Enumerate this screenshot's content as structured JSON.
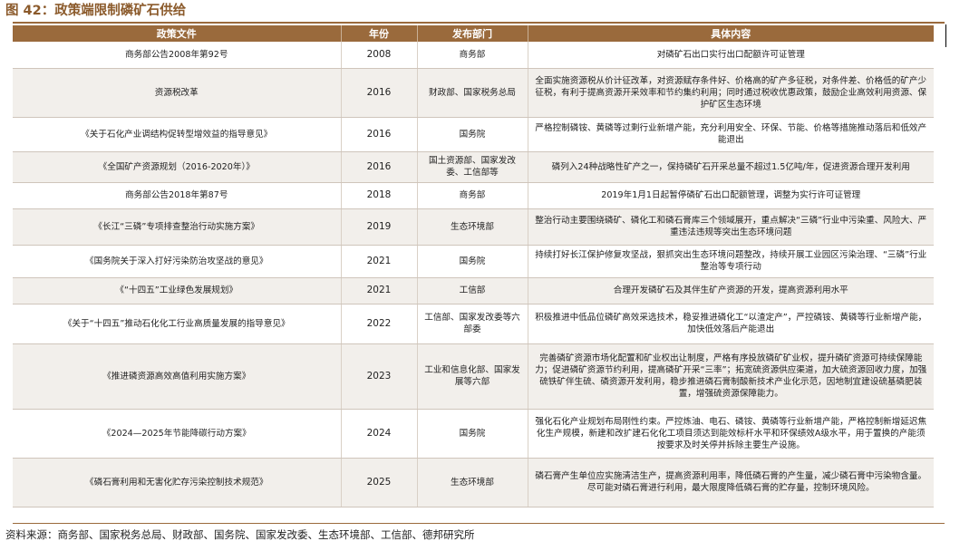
{
  "title": "图 42：政策端限制磷矿石供给",
  "headers": [
    "政策文件",
    "年份",
    "发布部门",
    "具体内容"
  ],
  "rows": [
    {
      "doc": "商务部公告2008年第92号",
      "year": "2008",
      "dept": "商务部",
      "content": "对磷矿石出口实行出口配额许可证管理"
    },
    {
      "doc": "资源税改革",
      "year": "2016",
      "dept": "财政部、国家税务总局",
      "content": "全面实施资源税从价计征改革，对资源赋存条件好、价格高的矿产多征税，对条件差、价格低的矿产少征税，有利于提高资源开采效率和节约集约利用；同时通过税收优惠政策，鼓励企业高效利用资源、保护矿区生态环境"
    },
    {
      "doc": "《关于石化产业调结构促转型增效益的指导意见》",
      "year": "2016",
      "dept": "国务院",
      "content": "严格控制磷铵、黄磷等过剩行业新增产能，充分利用安全、环保、节能、价格等措施推动落后和低效产能退出"
    },
    {
      "doc": "《全国矿产资源规划（2016-2020年）》",
      "year": "2016",
      "dept": "国土资源部、国家发改委、工信部等",
      "content": "磷列入24种战略性矿产之一，保持磷矿石开采总量不超过1.5亿吨/年，促进资源合理开发利用"
    },
    {
      "doc": "商务部公告2018年第87号",
      "year": "2018",
      "dept": "商务部",
      "content": "2019年1月1日起暂停磷矿石出口配额管理，调整为实行许可证管理"
    },
    {
      "doc": "《长江“三磷”专项排查整治行动实施方案》",
      "year": "2019",
      "dept": "生态环境部",
      "content": "整治行动主要围绕磷矿、磷化工和磷石膏库三个领域展开，重点解决“三磷”行业中污染重、风险大、严重违法违规等突出生态环境问题"
    },
    {
      "doc": "《国务院关于深入打好污染防治攻坚战的意见》",
      "year": "2021",
      "dept": "国务院",
      "content": "持续打好长江保护修复攻坚战，狠抓突出生态环境问题整改，持续开展工业园区污染治理、“三磷”行业整治等专项行动"
    },
    {
      "doc": "《“十四五”工业绿色发展规划》",
      "year": "2021",
      "dept": "工信部",
      "content": "合理开发磷矿石及其伴生矿产资源的开发，提高资源利用水平"
    },
    {
      "doc": "《关于“十四五”推动石化化工行业高质量发展的指导意见》",
      "year": "2022",
      "dept": "工信部、国家发改委等六部委",
      "content": "积极推进中低品位磷矿高效采选技术，稳妥推进磷化工“以渣定产”，严控磷铵、黄磷等行业新增产能，加快低效落后产能退出"
    },
    {
      "doc": "《推进磷资源高效高值利用实施方案》",
      "year": "2023",
      "dept": "工业和信息化部、国家发展等六部",
      "content": "完善磷矿资源市场化配置和矿业权出让制度，严格有序投放磷矿矿业权，提升磷矿资源可持续保障能力；促进磷矿资源节约利用，提高磷矿开采“三率”；拓宽硫资源供应渠道，加大硫资源回收力度，加强硫铁矿伴生硫、磷资源开发利用，稳步推进磷石膏制酸新技术产业化示范，因地制宜建设硫基磷肥装置，增强硫资源保障能力。"
    },
    {
      "doc": "《2024—2025年节能降碳行动方案》",
      "year": "2024",
      "dept": "国务院",
      "content": "强化石化产业规划布局刚性约束。严控炼油、电石、磷铵、黄磷等行业新增产能，严格控制新增延迟焦化生产规模，新建和改扩建石化化工项目须达到能效标杆水平和环保绩效A级水平，用于置换的产能须按要求及时关停并拆除主要生产设施。"
    },
    {
      "doc": "《磷石膏利用和无害化贮存污染控制技术规范》",
      "year": "2025",
      "dept": "生态环境部",
      "content": "磷石膏产生单位应实施清洁生产，提高资源利用率，降低磷石膏的产生量，减少磷石膏中污染物含量。 尽可能对磷石膏进行利用，最大限度降低磷石膏的贮存量，控制环境风险。"
    }
  ],
  "source": "资料来源：商务部、国家税务总局、财政部、国务院、国家发改委、生态环境部、工信部、德邦研究所"
}
